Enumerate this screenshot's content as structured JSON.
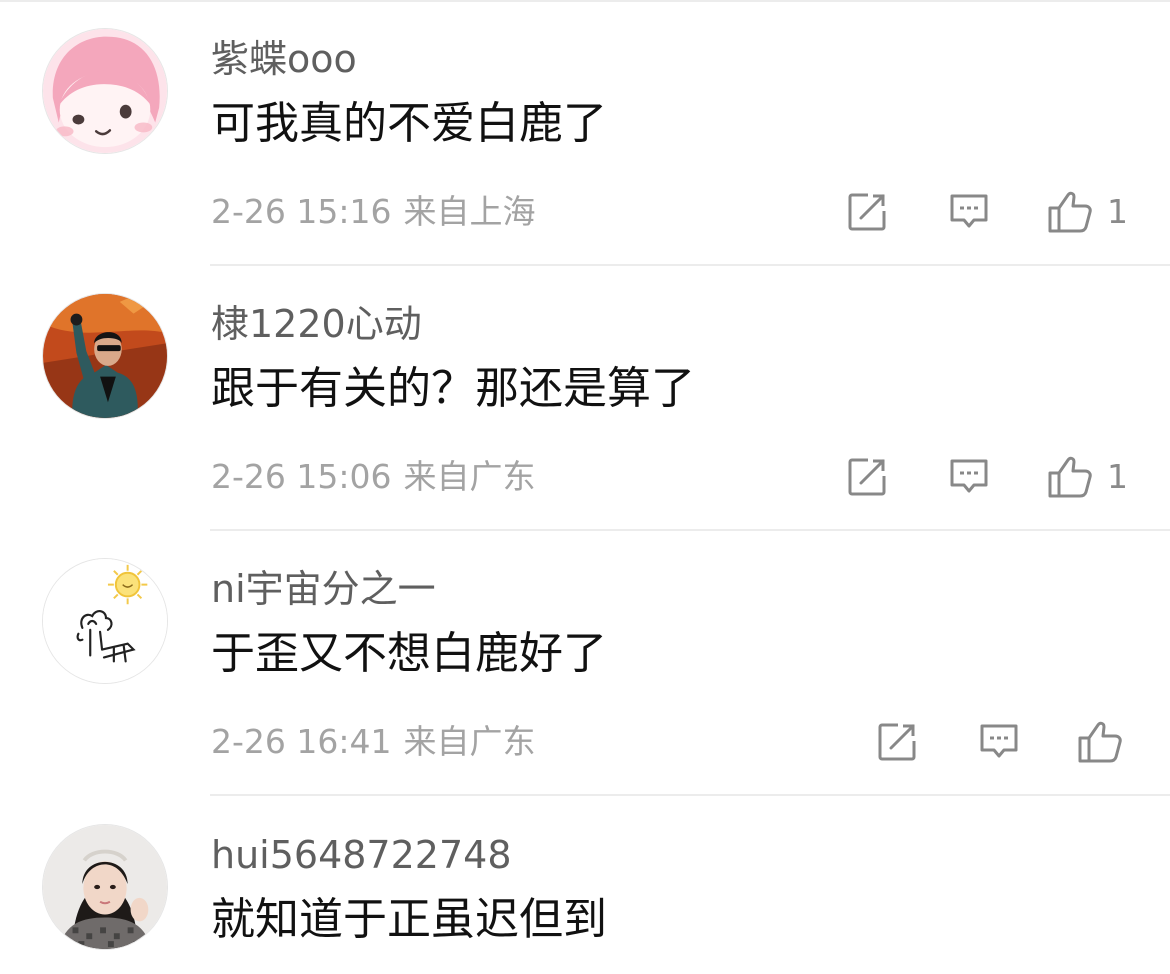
{
  "comments": [
    {
      "username": "紫蝶ooo",
      "text": "可我真的不爱白鹿了",
      "date": "2-26 15:16",
      "location": "来自上海",
      "likes": "1",
      "avatar_icon": "pink-cartoon-girl-avatar"
    },
    {
      "username": "棣1220心动",
      "text": "跟于有关的？那还是算了",
      "date": "2-26 15:06",
      "location": "来自广东",
      "likes": "1",
      "avatar_icon": "stage-performer-avatar"
    },
    {
      "username": "ni宇宙分之一",
      "text": "于歪又不想白鹿好了",
      "date": "2-26 16:41",
      "location": "来自广东",
      "likes": "",
      "avatar_icon": "sun-sketch-avatar"
    },
    {
      "username": "hui5648722748",
      "text": "就知道于正虽迟但到",
      "date": "",
      "location": "",
      "likes": "",
      "avatar_icon": "girl-portrait-avatar"
    }
  ],
  "icon_names": {
    "repost": "repost-icon",
    "reply": "comment-icon",
    "like": "thumbs-up-icon"
  },
  "colors": {
    "username": "#5f5f5f",
    "text": "#111111",
    "meta": "#a3a3a3",
    "icon": "#888888",
    "divider": "#ececec"
  }
}
